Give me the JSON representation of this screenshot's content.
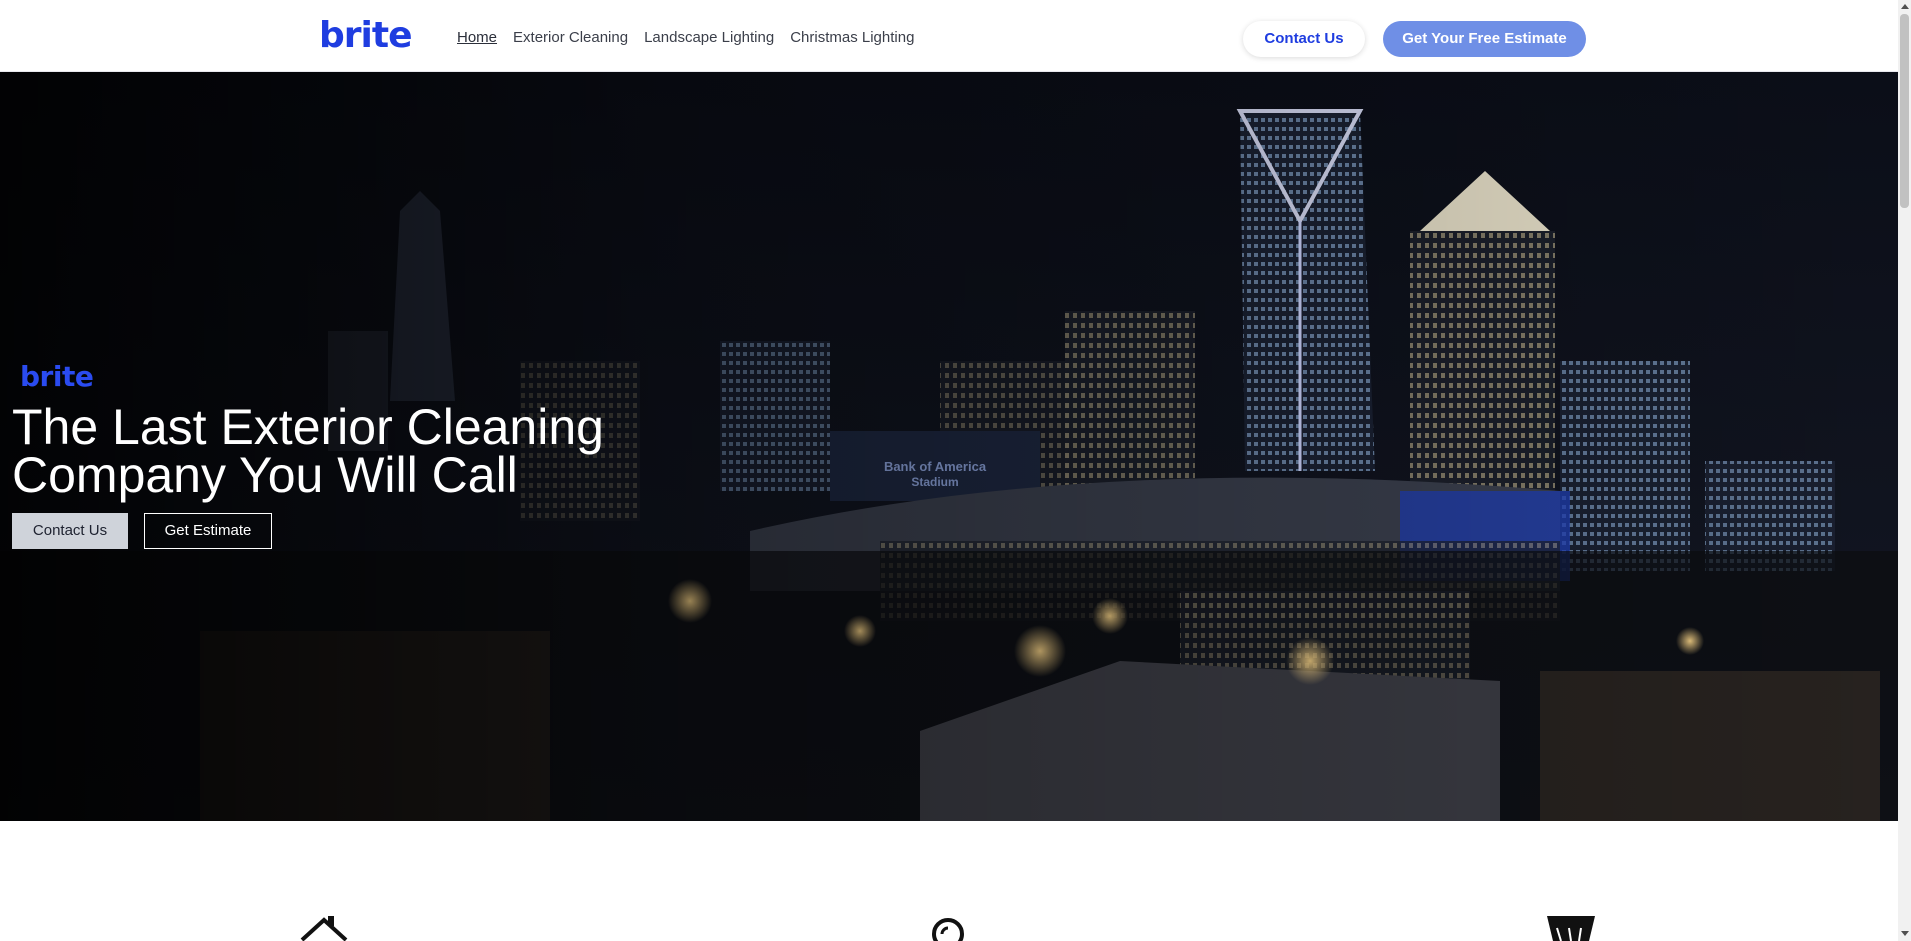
{
  "header": {
    "logo": "brite",
    "nav": [
      {
        "label": "Home",
        "active": true
      },
      {
        "label": "Exterior Cleaning",
        "active": false
      },
      {
        "label": "Landscape Lighting",
        "active": false
      },
      {
        "label": "Christmas Lighting",
        "active": false
      }
    ],
    "contact_label": "Contact Us",
    "estimate_label": "Get Your Free Estimate"
  },
  "hero": {
    "logo": "brite",
    "title_line1": "The Last Exterior Cleaning",
    "title_line2": "Company You Will Call",
    "contact_label": "Contact Us",
    "estimate_label": "Get Estimate",
    "background_image": "night city skyline with stadium"
  },
  "features": {
    "icons": [
      "house-icon",
      "magnifier-icon",
      "brush-icon"
    ]
  },
  "colors": {
    "brand_blue": "#1f3de0",
    "estimate_button": "#6f8fe6",
    "hero_button_light": "#cfd3da"
  }
}
